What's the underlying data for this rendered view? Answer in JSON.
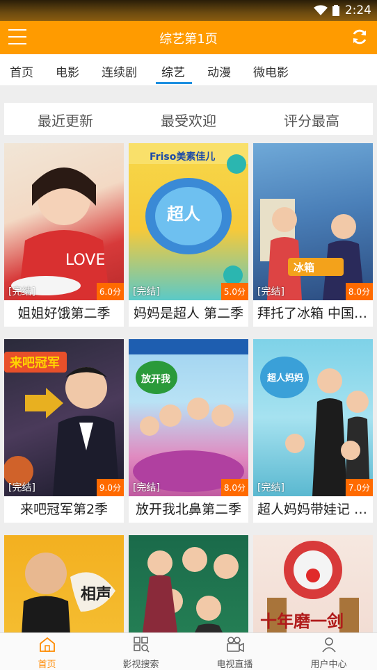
{
  "status": {
    "time": "2:24"
  },
  "header": {
    "title": "综艺第1页"
  },
  "tabs": [
    {
      "label": "首页"
    },
    {
      "label": "电影"
    },
    {
      "label": "连续剧"
    },
    {
      "label": "综艺"
    },
    {
      "label": "动漫"
    },
    {
      "label": "微电影"
    }
  ],
  "sort": [
    {
      "label": "最近更新"
    },
    {
      "label": "最受欢迎"
    },
    {
      "label": "评分最高"
    }
  ],
  "items": [
    {
      "name": "姐姐好饿第二季",
      "status": "[完结]",
      "score": "6.0分"
    },
    {
      "name": "妈妈是超人 第二季",
      "status": "[完结]",
      "score": "5.0分"
    },
    {
      "name": "拜托了冰箱 中国版 第二季",
      "status": "[完结]",
      "score": "8.0分"
    },
    {
      "name": "来吧冠军第2季",
      "status": "[完结]",
      "score": "9.0分"
    },
    {
      "name": "放开我北鼻第二季",
      "status": "[完结]",
      "score": "8.0分"
    },
    {
      "name": "超人妈妈带娃记 第二季",
      "status": "[完结]",
      "score": "7.0分"
    },
    {
      "name": "",
      "status": "",
      "score": ""
    },
    {
      "name": "",
      "status": "",
      "score": ""
    },
    {
      "name": "",
      "status": "",
      "score": ""
    }
  ],
  "nav": [
    {
      "label": "首页",
      "icon": "home-icon"
    },
    {
      "label": "影视搜索",
      "icon": "grid-search-icon"
    },
    {
      "label": "电视直播",
      "icon": "camera-icon"
    },
    {
      "label": "用户中心",
      "icon": "user-icon"
    }
  ],
  "colors": {
    "accent": "#ff9b00",
    "tab_indicator": "#1d8fe0",
    "score_bg": "#ff6a00",
    "nav_active": "#ff8a00"
  }
}
